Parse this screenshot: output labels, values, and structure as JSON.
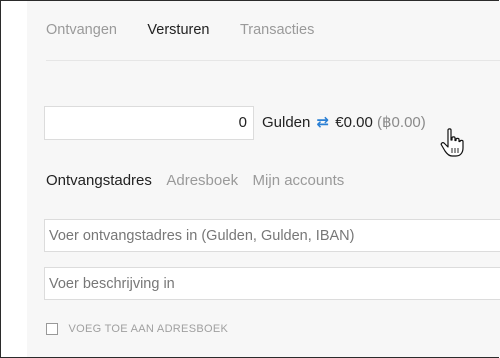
{
  "tabs": [
    {
      "label": "Ontvangen",
      "active": false
    },
    {
      "label": "Versturen",
      "active": true
    },
    {
      "label": "Transacties",
      "active": false
    }
  ],
  "amount": {
    "value": "0",
    "currency_label": "Gulden",
    "swap_icon": "swap-arrows-icon",
    "fiat_value": "€0.00",
    "alt_value": "(฿0.00)"
  },
  "address_tabs": [
    {
      "label": "Ontvangstadres",
      "active": true
    },
    {
      "label": "Adresboek",
      "active": false
    },
    {
      "label": "Mijn accounts",
      "active": false
    }
  ],
  "address_field": {
    "placeholder": "Voer ontvangstadres in (Gulden, Gulden, IBAN)"
  },
  "description_field": {
    "placeholder": "Voer beschrijving in"
  },
  "addressbook_checkbox": {
    "label": "VOEG TOE AAN ADRESBOEK",
    "checked": false
  },
  "colors": {
    "accent": "#2a7fd4",
    "panel_bg": "#f7f7f7"
  }
}
